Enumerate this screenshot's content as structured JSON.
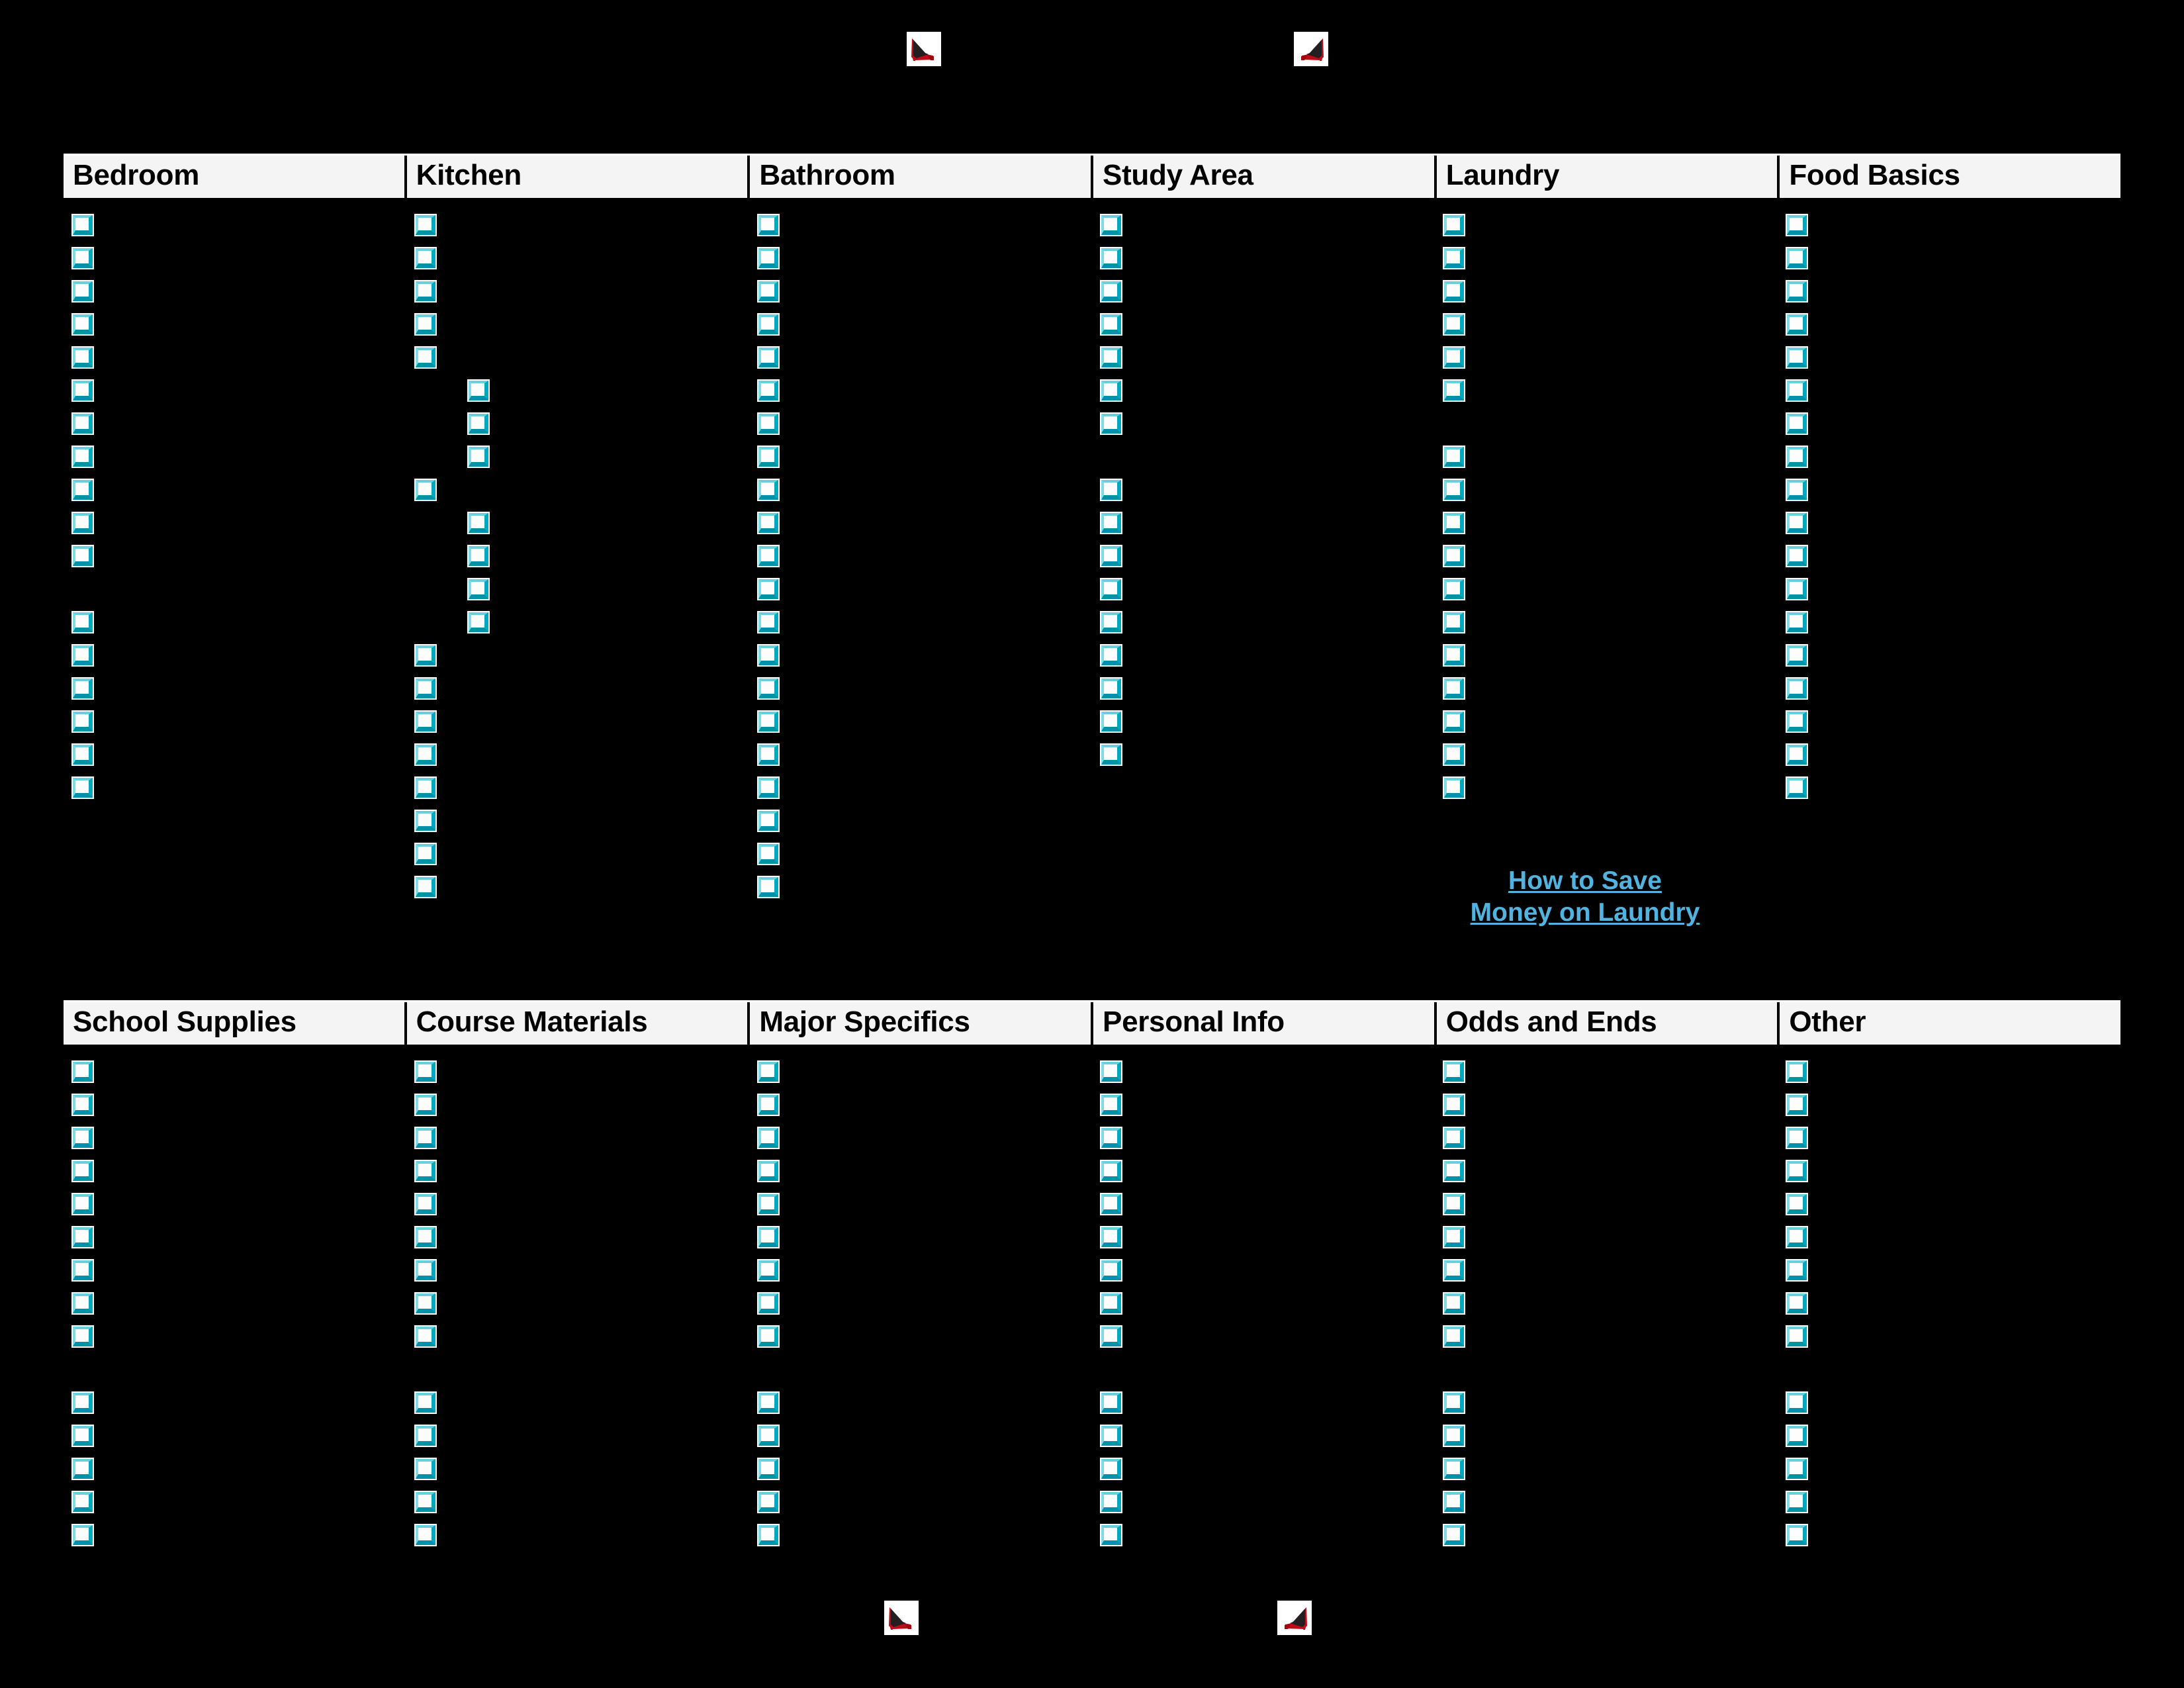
{
  "document": {
    "kind": "dorm-packing-checklist",
    "background_color": "#000000",
    "header_background": "#f4f4f4",
    "checkbox_border_color": "#00a8bd",
    "link_color": "#52b3e0",
    "decoration_icon": "red-high-heel-shoe-icon"
  },
  "decorations": {
    "top_left_shoe": "high-heel-shoe-icon",
    "top_right_shoe": "high-heel-shoe-icon",
    "bottom_left_shoe": "high-heel-shoe-icon",
    "bottom_right_shoe": "high-heel-shoe-icon"
  },
  "table_top": {
    "headers": [
      "Bedroom",
      "Kitchen",
      "Bathroom",
      "Study Area",
      "Laundry",
      "Food Basics"
    ],
    "columns": [
      {
        "name": "Bedroom",
        "rows": [
          {
            "type": "checkbox",
            "indent": 0
          },
          {
            "type": "checkbox",
            "indent": 0
          },
          {
            "type": "checkbox",
            "indent": 0
          },
          {
            "type": "checkbox",
            "indent": 0
          },
          {
            "type": "checkbox",
            "indent": 0
          },
          {
            "type": "checkbox",
            "indent": 0
          },
          {
            "type": "checkbox",
            "indent": 0
          },
          {
            "type": "checkbox",
            "indent": 0
          },
          {
            "type": "checkbox",
            "indent": 0
          },
          {
            "type": "checkbox",
            "indent": 0
          },
          {
            "type": "checkbox",
            "indent": 0
          },
          {
            "type": "gap"
          },
          {
            "type": "checkbox",
            "indent": 0
          },
          {
            "type": "checkbox",
            "indent": 0
          },
          {
            "type": "checkbox",
            "indent": 0
          },
          {
            "type": "checkbox",
            "indent": 0
          },
          {
            "type": "checkbox",
            "indent": 0
          },
          {
            "type": "checkbox",
            "indent": 0
          }
        ]
      },
      {
        "name": "Kitchen",
        "rows": [
          {
            "type": "checkbox",
            "indent": 0
          },
          {
            "type": "checkbox",
            "indent": 0
          },
          {
            "type": "checkbox",
            "indent": 0
          },
          {
            "type": "checkbox",
            "indent": 0
          },
          {
            "type": "checkbox",
            "indent": 0
          },
          {
            "type": "checkbox",
            "indent": 1
          },
          {
            "type": "checkbox",
            "indent": 1
          },
          {
            "type": "checkbox",
            "indent": 1
          },
          {
            "type": "checkbox",
            "indent": 0
          },
          {
            "type": "checkbox",
            "indent": 1
          },
          {
            "type": "checkbox",
            "indent": 1
          },
          {
            "type": "checkbox",
            "indent": 1
          },
          {
            "type": "checkbox",
            "indent": 1
          },
          {
            "type": "checkbox",
            "indent": 0
          },
          {
            "type": "checkbox",
            "indent": 0
          },
          {
            "type": "checkbox",
            "indent": 0
          },
          {
            "type": "checkbox",
            "indent": 0
          },
          {
            "type": "checkbox",
            "indent": 0
          },
          {
            "type": "checkbox",
            "indent": 0
          },
          {
            "type": "checkbox",
            "indent": 0
          },
          {
            "type": "checkbox",
            "indent": 0
          }
        ]
      },
      {
        "name": "Bathroom",
        "rows": [
          {
            "type": "checkbox",
            "indent": 0
          },
          {
            "type": "checkbox",
            "indent": 0
          },
          {
            "type": "checkbox",
            "indent": 0
          },
          {
            "type": "checkbox",
            "indent": 0
          },
          {
            "type": "checkbox",
            "indent": 0
          },
          {
            "type": "checkbox",
            "indent": 0
          },
          {
            "type": "checkbox",
            "indent": 0
          },
          {
            "type": "checkbox",
            "indent": 0
          },
          {
            "type": "checkbox",
            "indent": 0
          },
          {
            "type": "checkbox",
            "indent": 0
          },
          {
            "type": "checkbox",
            "indent": 0
          },
          {
            "type": "checkbox",
            "indent": 0
          },
          {
            "type": "checkbox",
            "indent": 0
          },
          {
            "type": "checkbox",
            "indent": 0
          },
          {
            "type": "checkbox",
            "indent": 0
          },
          {
            "type": "checkbox",
            "indent": 0
          },
          {
            "type": "checkbox",
            "indent": 0
          },
          {
            "type": "checkbox",
            "indent": 0
          },
          {
            "type": "checkbox",
            "indent": 0
          },
          {
            "type": "checkbox",
            "indent": 0
          },
          {
            "type": "checkbox",
            "indent": 0
          }
        ]
      },
      {
        "name": "Study Area",
        "rows": [
          {
            "type": "checkbox",
            "indent": 0
          },
          {
            "type": "checkbox",
            "indent": 0
          },
          {
            "type": "checkbox",
            "indent": 0
          },
          {
            "type": "checkbox",
            "indent": 0
          },
          {
            "type": "checkbox",
            "indent": 0
          },
          {
            "type": "checkbox",
            "indent": 0
          },
          {
            "type": "checkbox",
            "indent": 0
          },
          {
            "type": "gap"
          },
          {
            "type": "checkbox",
            "indent": 0
          },
          {
            "type": "checkbox",
            "indent": 0
          },
          {
            "type": "checkbox",
            "indent": 0
          },
          {
            "type": "checkbox",
            "indent": 0
          },
          {
            "type": "checkbox",
            "indent": 0
          },
          {
            "type": "checkbox",
            "indent": 0
          },
          {
            "type": "checkbox",
            "indent": 0
          },
          {
            "type": "checkbox",
            "indent": 0
          },
          {
            "type": "checkbox",
            "indent": 0
          }
        ]
      },
      {
        "name": "Laundry",
        "rows": [
          {
            "type": "checkbox",
            "indent": 0
          },
          {
            "type": "checkbox",
            "indent": 0
          },
          {
            "type": "checkbox",
            "indent": 0
          },
          {
            "type": "checkbox",
            "indent": 0
          },
          {
            "type": "checkbox",
            "indent": 0
          },
          {
            "type": "checkbox",
            "indent": 0
          },
          {
            "type": "gap"
          },
          {
            "type": "checkbox",
            "indent": 0
          },
          {
            "type": "checkbox",
            "indent": 0
          },
          {
            "type": "checkbox",
            "indent": 0
          },
          {
            "type": "checkbox",
            "indent": 0
          },
          {
            "type": "checkbox",
            "indent": 0
          },
          {
            "type": "checkbox",
            "indent": 0
          },
          {
            "type": "checkbox",
            "indent": 0
          },
          {
            "type": "checkbox",
            "indent": 0
          },
          {
            "type": "checkbox",
            "indent": 0
          },
          {
            "type": "checkbox",
            "indent": 0
          },
          {
            "type": "checkbox",
            "indent": 0
          }
        ]
      },
      {
        "name": "Food Basics",
        "rows": [
          {
            "type": "checkbox",
            "indent": 0
          },
          {
            "type": "checkbox",
            "indent": 0
          },
          {
            "type": "checkbox",
            "indent": 0
          },
          {
            "type": "checkbox",
            "indent": 0
          },
          {
            "type": "checkbox",
            "indent": 0
          },
          {
            "type": "checkbox",
            "indent": 0
          },
          {
            "type": "checkbox",
            "indent": 0
          },
          {
            "type": "checkbox",
            "indent": 0
          },
          {
            "type": "checkbox",
            "indent": 0
          },
          {
            "type": "checkbox",
            "indent": 0
          },
          {
            "type": "checkbox",
            "indent": 0
          },
          {
            "type": "checkbox",
            "indent": 0
          },
          {
            "type": "checkbox",
            "indent": 0
          },
          {
            "type": "checkbox",
            "indent": 0
          },
          {
            "type": "checkbox",
            "indent": 0
          },
          {
            "type": "checkbox",
            "indent": 0
          },
          {
            "type": "checkbox",
            "indent": 0
          },
          {
            "type": "checkbox",
            "indent": 0
          }
        ]
      }
    ]
  },
  "laundry_link": {
    "line1": "How to Save",
    "line2": "Money on Laundry",
    "full_text": "How to Save Money on Laundry"
  },
  "table_bottom": {
    "headers": [
      "School Supplies",
      "Course Materials",
      "Major Specifics",
      "Personal Info",
      "Odds and Ends",
      "Other"
    ],
    "columns": [
      {
        "name": "School Supplies",
        "checkbox_count": 14,
        "gap_after": 9
      },
      {
        "name": "Course Materials",
        "checkbox_count": 14,
        "gap_after": 9
      },
      {
        "name": "Major Specifics",
        "checkbox_count": 14,
        "gap_after": 9
      },
      {
        "name": "Personal Info",
        "checkbox_count": 14,
        "gap_after": 9
      },
      {
        "name": "Odds and Ends",
        "checkbox_count": 14,
        "gap_after": 9
      },
      {
        "name": "Other",
        "checkbox_count": 14,
        "gap_after": 9
      }
    ]
  }
}
